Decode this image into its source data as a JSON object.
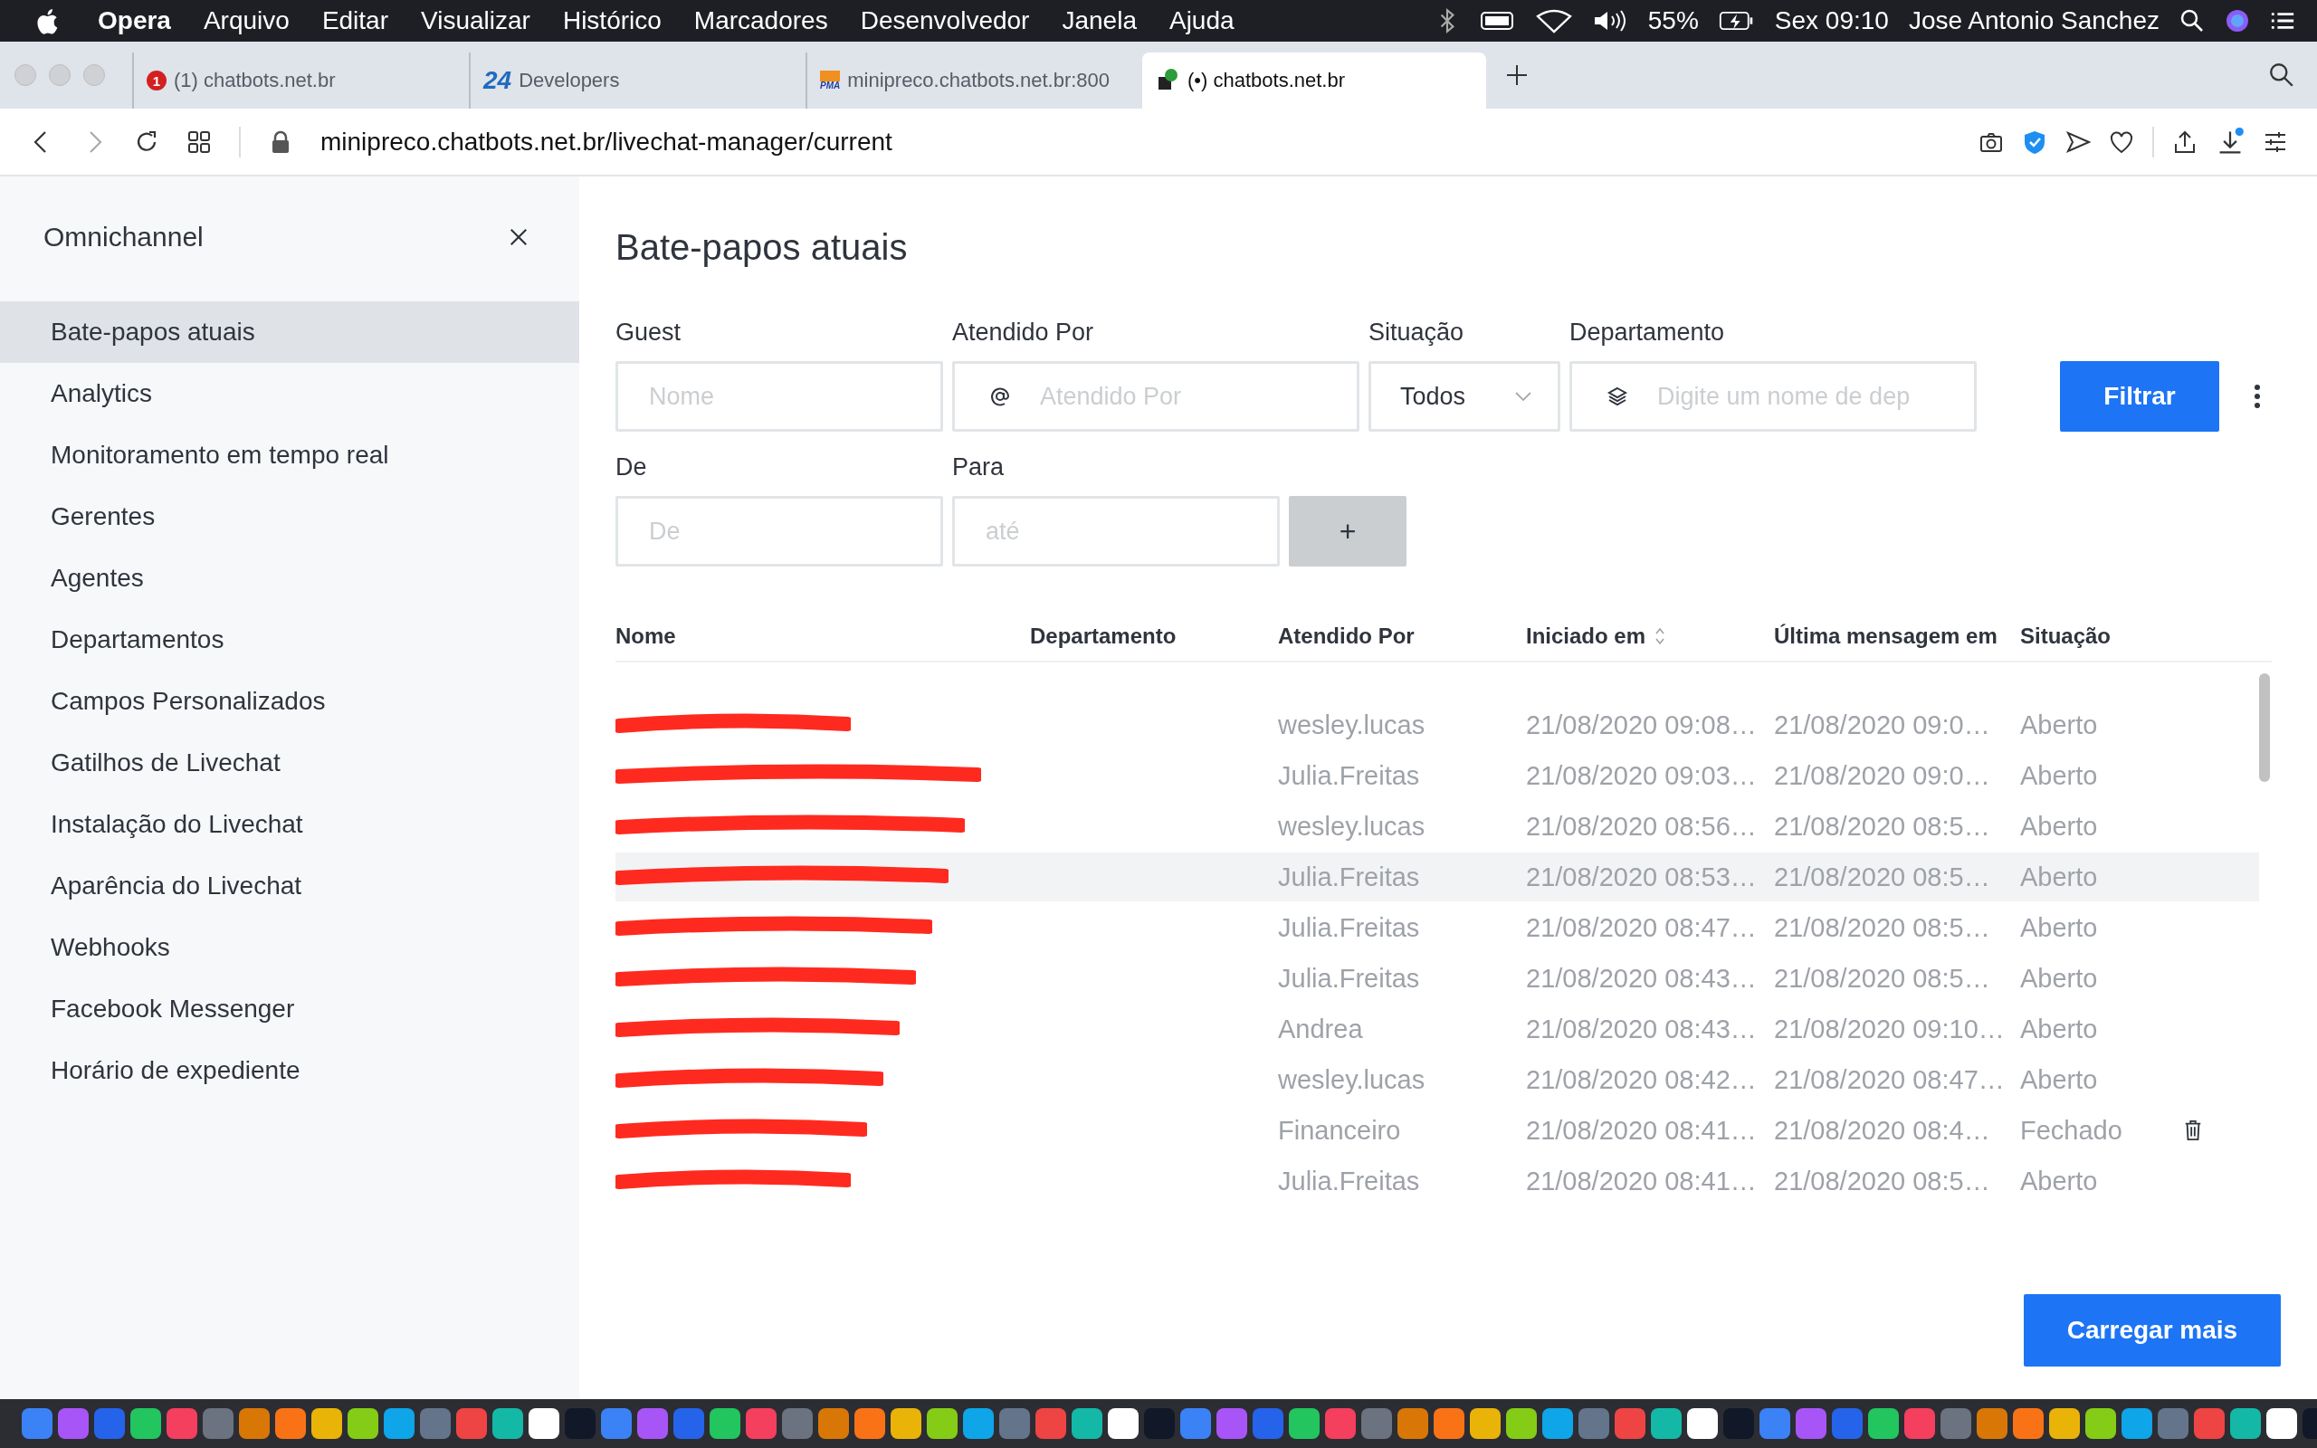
{
  "menubar": {
    "app": "Opera",
    "items": [
      "Arquivo",
      "Editar",
      "Visualizar",
      "Histórico",
      "Marcadores",
      "Desenvolvedor",
      "Janela",
      "Ajuda"
    ],
    "battery": "55%",
    "clock": "Sex 09:10",
    "user": "Jose Antonio Sanchez"
  },
  "tabs": [
    {
      "label": "(1) chatbots.net.br",
      "kind": "badge",
      "favicon_text": "1",
      "selected": false
    },
    {
      "label": "Developers",
      "kind": "logo24",
      "favicon_text": "24",
      "selected": false
    },
    {
      "label": "minipreco.chatbots.net.br:800",
      "kind": "pma",
      "favicon_text": "PMA",
      "selected": false
    },
    {
      "label": "(•) chatbots.net.br",
      "kind": "dot",
      "selected": true
    }
  ],
  "address_bar": {
    "url": "minipreco.chatbots.net.br/livechat-manager/current",
    "download_badge": true
  },
  "sidebar": {
    "title": "Omnichannel",
    "items": [
      {
        "label": "Bate-papos atuais",
        "selected": true
      },
      {
        "label": "Analytics",
        "selected": false
      },
      {
        "label": "Monitoramento em tempo real",
        "selected": false
      },
      {
        "label": "Gerentes",
        "selected": false
      },
      {
        "label": "Agentes",
        "selected": false
      },
      {
        "label": "Departamentos",
        "selected": false
      },
      {
        "label": "Campos Personalizados",
        "selected": false
      },
      {
        "label": "Gatilhos de Livechat",
        "selected": false
      },
      {
        "label": "Instalação do Livechat",
        "selected": false
      },
      {
        "label": "Aparência do Livechat",
        "selected": false
      },
      {
        "label": "Webhooks",
        "selected": false
      },
      {
        "label": "Facebook Messenger",
        "selected": false
      },
      {
        "label": "Horário de expediente",
        "selected": false
      }
    ]
  },
  "page": {
    "title": "Bate-papos atuais",
    "filters": {
      "guest": {
        "label": "Guest",
        "placeholder": "Nome"
      },
      "served_by": {
        "label": "Atendido Por",
        "placeholder": "Atendido Por"
      },
      "status": {
        "label": "Situação",
        "value": "Todos"
      },
      "department": {
        "label": "Departamento",
        "placeholder": "Digite um nome de dep"
      },
      "from": {
        "label": "De",
        "placeholder": "De"
      },
      "to": {
        "label": "Para",
        "placeholder": "até"
      },
      "filter_button": "Filtrar",
      "add_button": "+"
    },
    "table": {
      "columns": [
        {
          "label": "Nome",
          "sortable": false
        },
        {
          "label": "Departamento",
          "sortable": false
        },
        {
          "label": "Atendido Por",
          "sortable": false
        },
        {
          "label": "Iniciado em",
          "sortable": true
        },
        {
          "label": "Última mensagem em",
          "sortable": false
        },
        {
          "label": "Situação",
          "sortable": false
        }
      ],
      "rows": [
        {
          "served_by": "wesley.lucas",
          "started": "21/08/2020 09:08…",
          "last_message": "21/08/2020 09:0…",
          "status": "Aberto",
          "highlighted": false,
          "deletable": false
        },
        {
          "served_by": "Julia.Freitas",
          "started": "21/08/2020 09:03…",
          "last_message": "21/08/2020 09:0…",
          "status": "Aberto",
          "highlighted": false,
          "deletable": false
        },
        {
          "served_by": "wesley.lucas",
          "started": "21/08/2020 08:56…",
          "last_message": "21/08/2020 08:5…",
          "status": "Aberto",
          "highlighted": false,
          "deletable": false
        },
        {
          "served_by": "Julia.Freitas",
          "started": "21/08/2020 08:53…",
          "last_message": "21/08/2020 08:5…",
          "status": "Aberto",
          "highlighted": true,
          "deletable": false
        },
        {
          "served_by": "Julia.Freitas",
          "started": "21/08/2020 08:47…",
          "last_message": "21/08/2020 08:5…",
          "status": "Aberto",
          "highlighted": false,
          "deletable": false
        },
        {
          "served_by": "Julia.Freitas",
          "started": "21/08/2020 08:43…",
          "last_message": "21/08/2020 08:5…",
          "status": "Aberto",
          "highlighted": false,
          "deletable": false
        },
        {
          "served_by": "Andrea",
          "started": "21/08/2020 08:43…",
          "last_message": "21/08/2020 09:10…",
          "status": "Aberto",
          "highlighted": false,
          "deletable": false
        },
        {
          "served_by": "wesley.lucas",
          "started": "21/08/2020 08:42…",
          "last_message": "21/08/2020 08:47…",
          "status": "Aberto",
          "highlighted": false,
          "deletable": false
        },
        {
          "served_by": "Financeiro",
          "started": "21/08/2020 08:41…",
          "last_message": "21/08/2020 08:4…",
          "status": "Fechado",
          "highlighted": false,
          "deletable": true
        },
        {
          "served_by": "Julia.Freitas",
          "started": "21/08/2020 08:41…",
          "last_message": "21/08/2020 08:5…",
          "status": "Aberto",
          "highlighted": false,
          "deletable": false
        }
      ]
    },
    "load_more": "Carregar mais"
  }
}
